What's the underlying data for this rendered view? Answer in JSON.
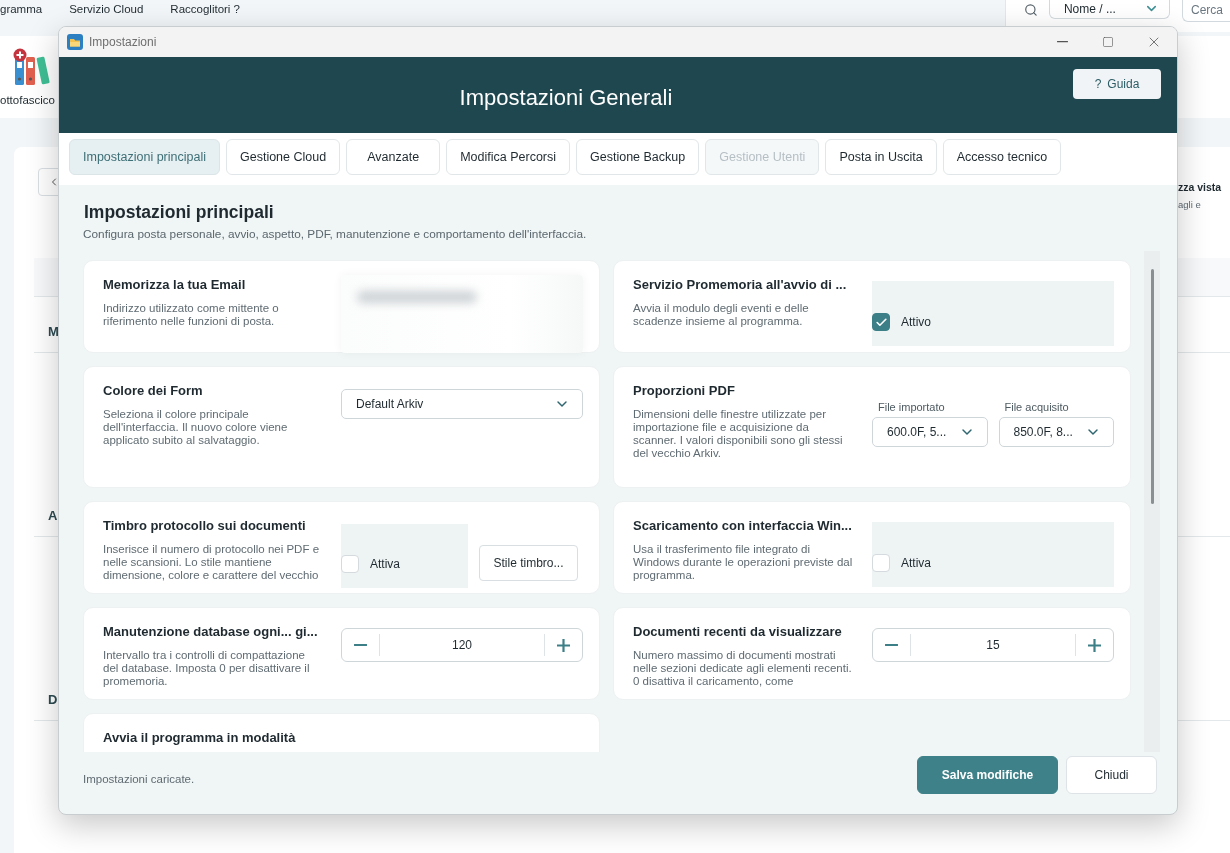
{
  "background_app": {
    "menu": [
      {
        "label": "gramma"
      },
      {
        "label": "Servizio Cloud"
      },
      {
        "label": "Raccoglitori ?"
      }
    ],
    "sort_select": {
      "value": "Nome / ..."
    },
    "search": {
      "placeholder": "Cerca"
    },
    "ribbon_button": {
      "label": "ottofascico"
    },
    "group_letters": [
      "M",
      "A",
      "D"
    ],
    "side_panel": {
      "title": "zza vista",
      "text": "agli e"
    }
  },
  "window": {
    "title": "Impostazioni"
  },
  "header": {
    "title": "Impostazioni Generali",
    "help_button": {
      "icon": "?",
      "label": "Guida"
    }
  },
  "tabs": [
    {
      "label": "Impostazioni principali",
      "selected": true,
      "disabled": false
    },
    {
      "label": "Gestione Cloud",
      "selected": false,
      "disabled": false
    },
    {
      "label": "Avanzate",
      "selected": false,
      "disabled": false
    },
    {
      "label": "Modifica Percorsi",
      "selected": false,
      "disabled": false
    },
    {
      "label": "Gestione Backup",
      "selected": false,
      "disabled": false
    },
    {
      "label": "Gestione Utenti",
      "selected": false,
      "disabled": true
    },
    {
      "label": "Posta in Uscita",
      "selected": false,
      "disabled": false
    },
    {
      "label": "Accesso tecnico",
      "selected": false,
      "disabled": false
    }
  ],
  "section": {
    "title": "Impostazioni principali",
    "subtitle": "Configura posta personale, avvio, aspetto, PDF, manutenzione e comportamento dell'interfaccia."
  },
  "settings": [
    {
      "kind": "email",
      "title": "Memorizza la tua Email",
      "description": "Indirizzo utilizzato come mittente o riferimento nelle funzioni di posta."
    },
    {
      "kind": "checkbox",
      "title": "Servizio Promemoria all'avvio di ...",
      "description": "Avvia il modulo degli eventi e delle scadenze insieme al programma.",
      "checkbox": {
        "label": "Attivo",
        "checked": true
      }
    },
    {
      "kind": "select",
      "title": "Colore dei Form",
      "description": "Seleziona il colore principale dell'interfaccia. Il nuovo colore viene applicato subito al salvataggio.",
      "select": {
        "value": "Default Arkiv"
      }
    },
    {
      "kind": "select_pair",
      "title": "Proporzioni PDF",
      "description": "Dimensioni delle finestre utilizzate per importazione file e acquisizione da scanner. I valori disponibili sono gli stessi del vecchio Arkiv.",
      "selects": [
        {
          "label": "File importato",
          "value": "600.0F, 5..."
        },
        {
          "label": "File acquisito",
          "value": "850.0F, 8..."
        }
      ]
    },
    {
      "kind": "checkbox_button",
      "title": "Timbro protocollo sui documenti",
      "description": "Inserisce il numero di protocollo nei PDF e nelle scansioni. Lo stile mantiene dimensione, colore e carattere del vecchio",
      "checkbox": {
        "label": "Attiva",
        "checked": false
      },
      "button": {
        "label": "Stile timbro..."
      }
    },
    {
      "kind": "checkbox",
      "title": "Scaricamento con interfaccia Win...",
      "description": "Usa il trasferimento file integrato di Windows durante le operazioni previste dal programma.",
      "checkbox": {
        "label": "Attiva",
        "checked": false
      }
    },
    {
      "kind": "stepper",
      "title": "Manutenzione database ogni... gi...",
      "description": "Intervallo tra i controlli di compattazione del database. Imposta 0 per disattivare il promemoria.",
      "value": "120"
    },
    {
      "kind": "stepper",
      "title": "Documenti recenti da visualizzare",
      "description": "Numero massimo di documenti mostrati nelle sezioni dedicate agli elementi recenti. 0 disattiva il caricamento, come",
      "value": "15"
    },
    {
      "kind": "title_only",
      "title": "Avvia il programma in modalità"
    }
  ],
  "footer": {
    "status": "Impostazioni caricate.",
    "buttons": [
      {
        "kind": "primary",
        "label": "Salva modifiche"
      },
      {
        "kind": "secondary",
        "label": "Chiudi"
      }
    ]
  }
}
